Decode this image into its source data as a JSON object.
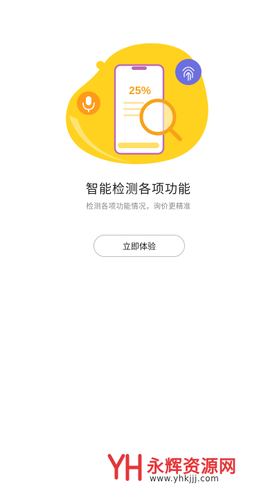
{
  "hero": {
    "percent_text": "25%",
    "icons": [
      "microphone-icon",
      "fingerprint-icon",
      "magnifier-icon",
      "phone-illustration"
    ],
    "colors": {
      "blob": "#ffd21f",
      "mic_circle": "#ff9a1a",
      "fingerprint_circle": "#6d6fe0",
      "phone_frame": "#c06ab3",
      "accent_orange": "#f7a21b"
    }
  },
  "main": {
    "title": "智能检测各项功能",
    "subtitle": "检测各项功能情况，询价更精准",
    "cta_label": "立即体验"
  },
  "watermark": {
    "name": "永辉资源网",
    "url": "www.yhkjjj.com",
    "color": "#e4363a"
  }
}
